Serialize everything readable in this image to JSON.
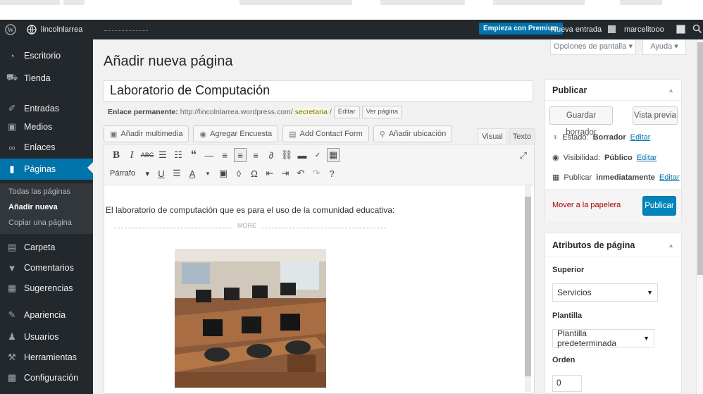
{
  "adminbar": {
    "site_name": "lincolnlarrea",
    "premium_label": "Empieza con Premium",
    "new_entry_label": "Nueva entrada",
    "user_name": "marcelitooo"
  },
  "sidebar": {
    "items": [
      {
        "label": "Escritorio",
        "icon": "dashboard-icon"
      },
      {
        "label": "Tienda",
        "icon": "cart-icon"
      },
      {
        "label": "Entradas",
        "icon": "pin-icon"
      },
      {
        "label": "Medios",
        "icon": "media-icon"
      },
      {
        "label": "Enlaces",
        "icon": "link-icon"
      },
      {
        "label": "Páginas",
        "icon": "page-icon"
      },
      {
        "label": "Carpeta",
        "icon": "folder-icon"
      },
      {
        "label": "Comentarios",
        "icon": "comment-icon"
      },
      {
        "label": "Sugerencias",
        "icon": "feedback-icon"
      },
      {
        "label": "Apariencia",
        "icon": "brush-icon"
      },
      {
        "label": "Usuarios",
        "icon": "users-icon"
      },
      {
        "label": "Herramientas",
        "icon": "wrench-icon"
      },
      {
        "label": "Configuración",
        "icon": "settings-icon"
      }
    ],
    "submenu": [
      "Todas las páginas",
      "Añadir nueva",
      "Copiar una página"
    ]
  },
  "header": {
    "title": "Añadir nueva página",
    "screen_options": "Opciones de pantalla",
    "help": "Ayuda"
  },
  "editor": {
    "post_title": "Laboratorio de Computación",
    "permalink_label": "Enlace permanente:",
    "permalink_base": "http://lincolnlarrea.wordpress.com/",
    "permalink_slug": "secretaria",
    "edit_label": "Editar",
    "view_label": "Ver página",
    "media_buttons": [
      "Añadir multimedia",
      "Agregar Encuesta",
      "Add Contact Form",
      "Añadir ubicación"
    ],
    "tab_visual": "Visual",
    "tab_text": "Texto",
    "format_select": "Párrafo",
    "body_text": "El laboratorio de computación que es para el uso de la comunidad educativa:",
    "more_label": "MORE"
  },
  "publish": {
    "title": "Publicar",
    "save_draft": "Guardar borrador",
    "preview": "Vista previa",
    "status_label": "Estado:",
    "status_value": "Borrador",
    "visibility_label": "Visibilidad:",
    "visibility_value": "Público",
    "publish_label": "Publicar",
    "publish_value": "inmediatamente",
    "edit_link": "Editar",
    "trash": "Mover a la papelera",
    "publish_button": "Publicar"
  },
  "attributes": {
    "title": "Atributos de página",
    "parent_label": "Superior",
    "parent_value": "Servicios",
    "template_label": "Plantilla",
    "template_value": "Plantilla predeterminada",
    "order_label": "Orden",
    "order_value": "0"
  },
  "colors": {
    "adminbar_bg": "#23282d",
    "accent": "#0073aa",
    "primary_button": "#0085ba",
    "trash_link": "#a00"
  }
}
